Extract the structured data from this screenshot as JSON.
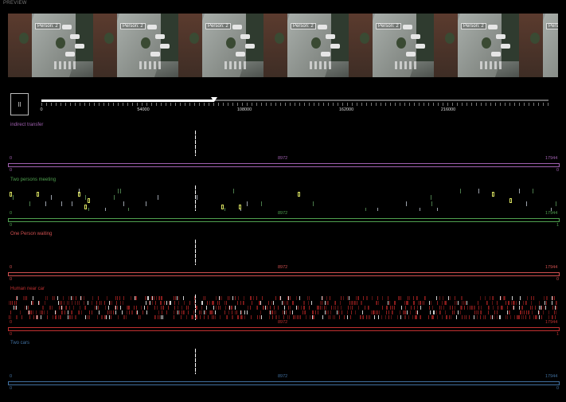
{
  "preview": {
    "label": "PREVIEW",
    "frame_tag": "Person: 2",
    "frame_count": 7
  },
  "player": {
    "play_label": "II",
    "progress": 0.34,
    "axis_ticks": [
      "0",
      "54000",
      "108000",
      "162000",
      "216000"
    ]
  },
  "tracks": [
    {
      "id": "indirect-transfer",
      "title": "indirect transfer",
      "color": "#a060b0",
      "left_value": "0",
      "mid_value": "8972",
      "right_value": "17944",
      "bar_left": "0",
      "bar_right": "0"
    },
    {
      "id": "two-persons-meeting",
      "title": "Two persons meeting",
      "color": "#4fa04f",
      "left_value": "0",
      "mid_value": "8972",
      "right_value": "17944",
      "bar_left": "0",
      "bar_right": "1"
    },
    {
      "id": "one-person-waiting",
      "title": "One Person waiting",
      "color": "#d05050",
      "left_value": "0",
      "mid_value": "8972",
      "right_value": "17944",
      "bar_left": "0",
      "bar_right": "0"
    },
    {
      "id": "human-near-car",
      "title": "Human near car",
      "color": "#c03030",
      "left_value": "0",
      "mid_value": "8972",
      "right_value": "17944",
      "bar_left": "0",
      "bar_right": "1"
    },
    {
      "id": "two-cars",
      "title": "Two cars",
      "color": "#4070a0",
      "left_value": "0",
      "mid_value": "8972",
      "right_value": "17944",
      "bar_left": "0",
      "bar_right": "0"
    }
  ],
  "icons": {
    "play": "pause-icon"
  }
}
